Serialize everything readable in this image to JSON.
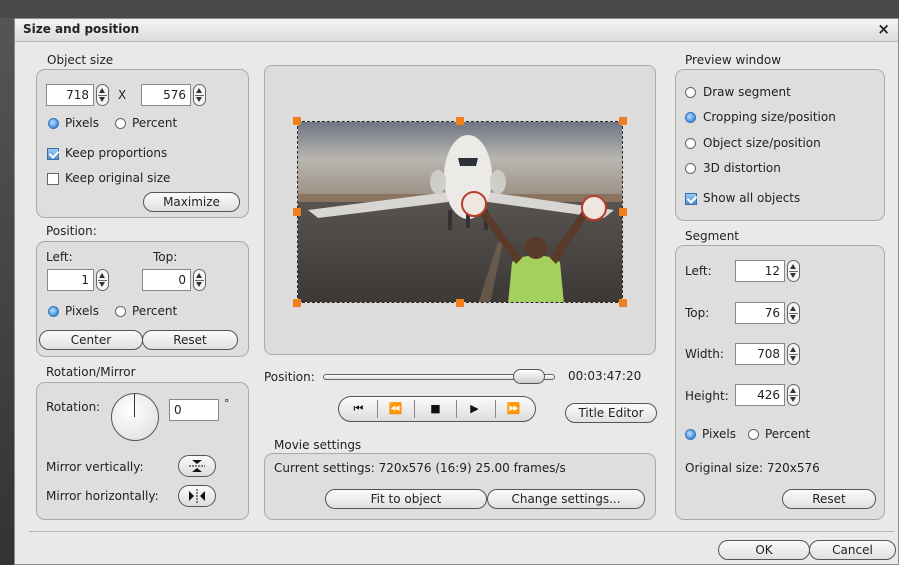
{
  "dialog": {
    "title": "Size and position",
    "close_glyph": "×"
  },
  "object_size": {
    "group_label": "Object size",
    "width": "718",
    "x_label": "X",
    "height": "576",
    "unit_pixels": "Pixels",
    "unit_percent": "Percent",
    "selected_unit": "Pixels",
    "keep_proportions_label": "Keep proportions",
    "keep_proportions_checked": true,
    "keep_original_label": "Keep original size",
    "keep_original_checked": false,
    "maximize_label": "Maximize"
  },
  "position": {
    "group_label": "Position:",
    "left_label": "Left:",
    "left_value": "1",
    "top_label": "Top:",
    "top_value": "0",
    "unit_pixels": "Pixels",
    "unit_percent": "Percent",
    "selected_unit": "Pixels",
    "center_label": "Center",
    "reset_label": "Reset"
  },
  "rotation": {
    "group_label": "Rotation/Mirror",
    "rotation_label": "Rotation:",
    "rotation_value": "0",
    "degree_symbol": "°",
    "mirror_vertical_label": "Mirror vertically:",
    "mirror_horizontal_label": "Mirror horizontally:"
  },
  "preview": {
    "image_icon": "airplane-marshaller-image",
    "position_label": "Position:",
    "timecode": "00:03:47:20",
    "title_editor_label": "Title Editor",
    "transport_icons": [
      "skip-to-start-icon",
      "rewind-icon",
      "stop-icon",
      "play-icon",
      "fast-forward-icon"
    ],
    "transport_glyphs": [
      "⏮",
      "⏪",
      "■",
      "▶",
      "⏩"
    ]
  },
  "movie_settings": {
    "group_label": "Movie settings",
    "current": "Current settings: 720x576 (16:9) 25.00 frames/s",
    "fit_label": "Fit to object",
    "change_label": "Change settings..."
  },
  "preview_window": {
    "group_label": "Preview window",
    "options": [
      "Draw segment",
      "Cropping size/position",
      "Object size/position",
      "3D distortion"
    ],
    "selected": "Cropping size/position",
    "show_all_label": "Show all objects",
    "show_all_checked": true
  },
  "segment": {
    "group_label": "Segment",
    "left_label": "Left:",
    "left_value": "12",
    "top_label": "Top:",
    "top_value": "76",
    "width_label": "Width:",
    "width_value": "708",
    "height_label": "Height:",
    "height_value": "426",
    "unit_pixels": "Pixels",
    "unit_percent": "Percent",
    "selected_unit": "Pixels",
    "original_size": "Original size:  720x576",
    "reset_label": "Reset"
  },
  "footer": {
    "ok_label": "OK",
    "cancel_label": "Cancel"
  },
  "colors": {
    "accent_blue": "#3c8ee0",
    "handle_orange": "#f07f1c",
    "dialog_bg": "#e9e9e9"
  }
}
